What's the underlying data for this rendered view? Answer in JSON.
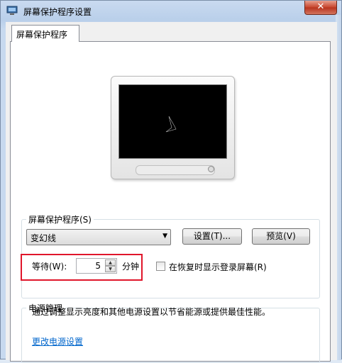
{
  "window": {
    "title": "屏幕保护程序设置",
    "close_label": "✕",
    "icon": "monitor-settings-icon"
  },
  "tab": {
    "label": "屏幕保护程序"
  },
  "screensaver": {
    "group_label": "屏幕保护程序(S)",
    "selected": "变幻线",
    "settings_button": "设置(T)...",
    "preview_button": "预览(V)",
    "wait_label": "等待(W):",
    "wait_value": "5",
    "minutes_label": "分钟",
    "resume_checkbox_label": "在恢复时显示登录屏幕(R)",
    "resume_checked": false
  },
  "power": {
    "group_label": "电源管理",
    "description": "通过调整显示亮度和其他电源设置以节省能源或提供最佳性能。",
    "link": "更改电源设置"
  },
  "colors": {
    "highlight": "#e0162b",
    "link": "#0066cc"
  }
}
